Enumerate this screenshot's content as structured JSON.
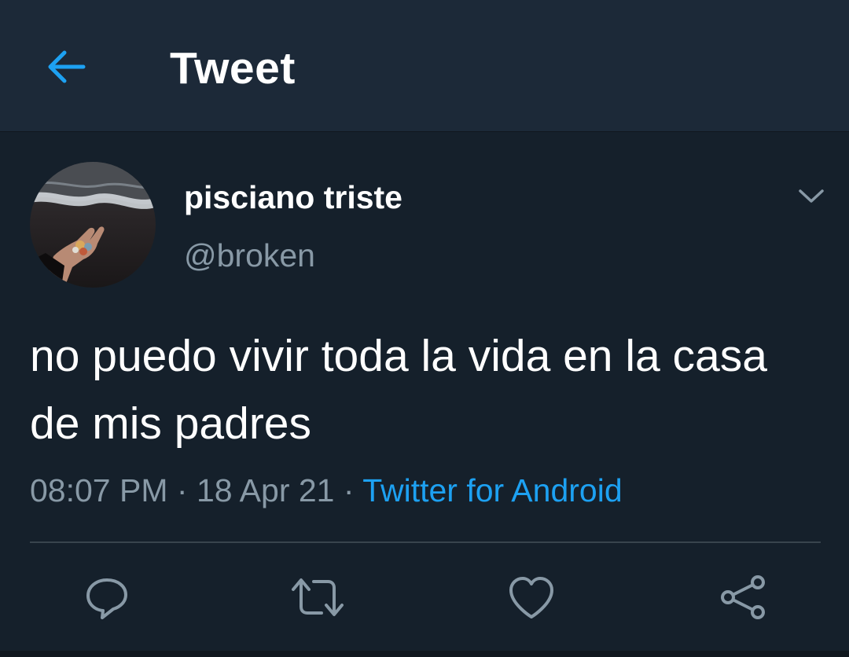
{
  "header": {
    "title": "Tweet",
    "back_icon": "arrow-left-icon",
    "accent_color": "#1da1f2"
  },
  "tweet": {
    "display_name": "pisciano triste",
    "handle": "@broken",
    "text": "no puedo vivir toda la vida en la casa de mis padres",
    "time": "08:07 PM",
    "date": "18 Apr 21",
    "separator": "·",
    "source": "Twitter for Android"
  },
  "actions": [
    {
      "icon": "reply-icon"
    },
    {
      "icon": "retweet-icon"
    },
    {
      "icon": "like-icon"
    },
    {
      "icon": "share-icon"
    }
  ],
  "colors": {
    "background": "#15202b",
    "header": "#1c2938",
    "muted_text": "#8899a6",
    "link": "#1da1f2"
  }
}
